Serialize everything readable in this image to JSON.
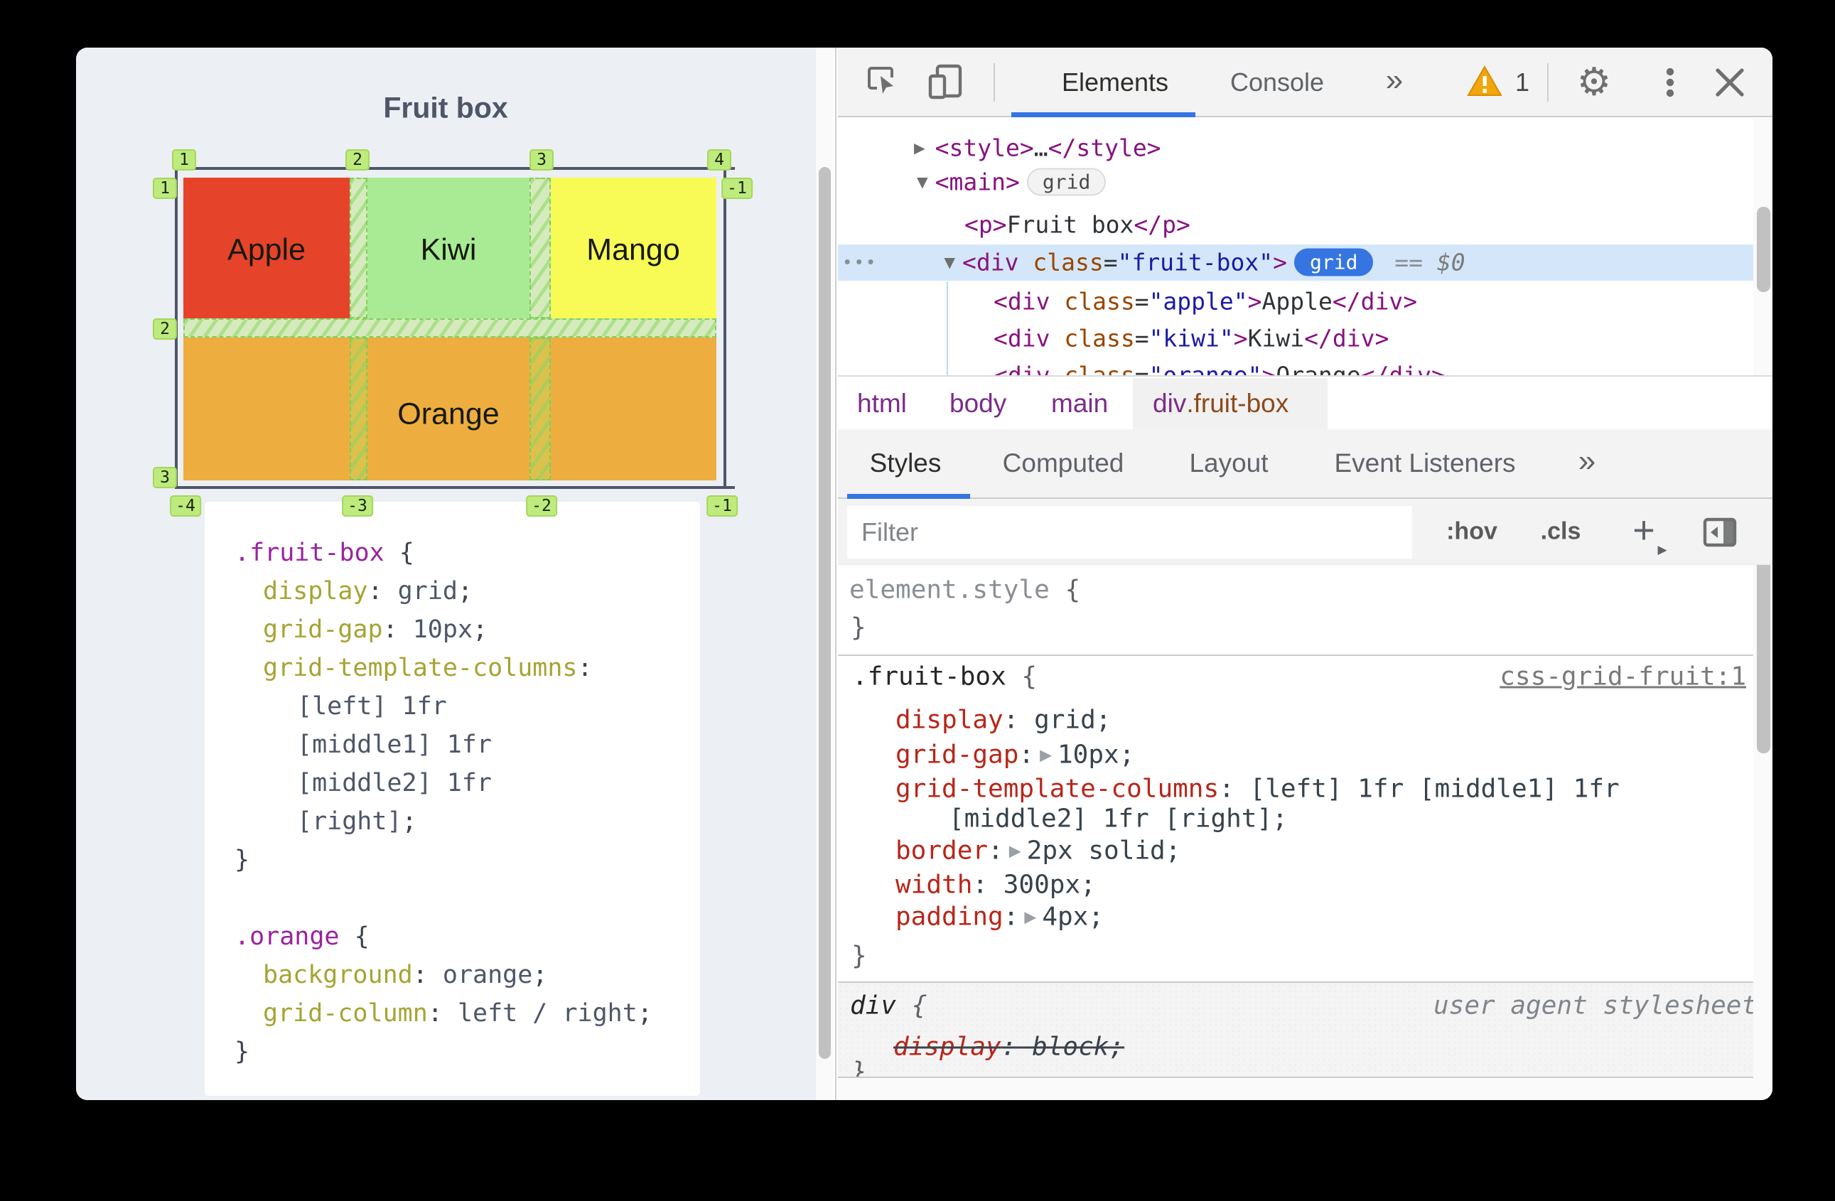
{
  "page": {
    "title": "Fruit box",
    "cells": {
      "apple": "Apple",
      "kiwi": "Kiwi",
      "mango": "Mango",
      "orange": "Orange"
    },
    "colors": {
      "apple": "#e6442a",
      "kiwi": "#a8eb94",
      "mango": "#f8fb56",
      "orange": "#edae3f",
      "overlay_line": "#4e5668",
      "badge_bg": "#beeb7d"
    },
    "overlay_badges": {
      "top": [
        "1",
        "2",
        "3",
        "4"
      ],
      "left": [
        "1",
        "2",
        "3"
      ],
      "right": [
        "-1"
      ],
      "bottom": [
        "-4",
        "-3",
        "-2",
        "-1"
      ]
    },
    "code": [
      {
        "parts": [
          {
            "t": ".fruit-box",
            "c": "psel"
          },
          {
            "t": " {",
            "c": "ppun"
          }
        ]
      },
      {
        "parts": [
          {
            "t": "display",
            "c": "pprop"
          },
          {
            "t": ": ",
            "c": "ppun"
          },
          {
            "t": "grid",
            "c": "pval"
          },
          {
            "t": ";",
            "c": "ppun"
          }
        ]
      },
      {
        "parts": [
          {
            "t": "grid-gap",
            "c": "pprop"
          },
          {
            "t": ": ",
            "c": "ppun"
          },
          {
            "t": "10px",
            "c": "pval"
          },
          {
            "t": ";",
            "c": "ppun"
          }
        ]
      },
      {
        "parts": [
          {
            "t": "grid-template-columns",
            "c": "pprop"
          },
          {
            "t": ":",
            "c": "ppun"
          }
        ]
      },
      {
        "parts": [
          {
            "t": "[left] 1fr",
            "c": "pval"
          }
        ]
      },
      {
        "parts": [
          {
            "t": "[middle1] 1fr",
            "c": "pval"
          }
        ]
      },
      {
        "parts": [
          {
            "t": "[middle2] 1fr",
            "c": "pval"
          }
        ]
      },
      {
        "parts": [
          {
            "t": "[right]",
            "c": "pval"
          },
          {
            "t": ";",
            "c": "ppun"
          }
        ]
      },
      {
        "parts": [
          {
            "t": "}",
            "c": "ppun"
          }
        ]
      },
      {
        "parts": []
      },
      {
        "parts": [
          {
            "t": ".orange",
            "c": "psel"
          },
          {
            "t": " {",
            "c": "ppun"
          }
        ]
      },
      {
        "parts": [
          {
            "t": "background",
            "c": "pprop"
          },
          {
            "t": ": ",
            "c": "ppun"
          },
          {
            "t": "orange",
            "c": "pval"
          },
          {
            "t": ";",
            "c": "ppun"
          }
        ]
      },
      {
        "parts": [
          {
            "t": "grid-column",
            "c": "pprop"
          },
          {
            "t": ": ",
            "c": "ppun"
          },
          {
            "t": "left / right",
            "c": "pval"
          },
          {
            "t": ";",
            "c": "ppun"
          }
        ]
      },
      {
        "parts": [
          {
            "t": "}",
            "c": "ppun"
          }
        ]
      }
    ]
  },
  "devtools": {
    "toolbar": {
      "tabs": [
        "Elements",
        "Console"
      ],
      "more": "»",
      "warning_count": "1"
    },
    "dom": {
      "rows": [
        {
          "a": [
            {
              "t": "<style>",
              "c": "tag"
            },
            {
              "t": "…",
              "c": "txt"
            },
            {
              "t": "</style>",
              "c": "tag"
            }
          ]
        },
        {
          "a": [
            {
              "t": "<main>",
              "c": "tag"
            }
          ],
          "pill": "grid"
        },
        {
          "a": [
            {
              "t": "<p>",
              "c": "tag"
            },
            {
              "t": "Fruit box",
              "c": "txt"
            },
            {
              "t": "</p>",
              "c": "tag"
            }
          ]
        },
        {
          "a": [
            {
              "t": "<div ",
              "c": "tag"
            },
            {
              "t": "class",
              "c": "attr"
            },
            {
              "t": "=",
              "c": "txt"
            },
            {
              "t": "\"fruit-box\"",
              "c": "str"
            },
            {
              "t": ">",
              "c": "tag"
            }
          ],
          "pill": "grid",
          "b": [
            {
              "t": " == ",
              "c": "gry"
            },
            {
              "t": "$0",
              "c": "dol"
            }
          ]
        },
        {
          "a": [
            {
              "t": "<div ",
              "c": "tag"
            },
            {
              "t": "class",
              "c": "attr"
            },
            {
              "t": "=",
              "c": "txt"
            },
            {
              "t": "\"apple\"",
              "c": "str"
            },
            {
              "t": ">",
              "c": "tag"
            },
            {
              "t": "Apple",
              "c": "txt"
            },
            {
              "t": "</div>",
              "c": "tag"
            }
          ]
        },
        {
          "a": [
            {
              "t": "<div ",
              "c": "tag"
            },
            {
              "t": "class",
              "c": "attr"
            },
            {
              "t": "=",
              "c": "txt"
            },
            {
              "t": "\"kiwi\"",
              "c": "str"
            },
            {
              "t": ">",
              "c": "tag"
            },
            {
              "t": "Kiwi",
              "c": "txt"
            },
            {
              "t": "</div>",
              "c": "tag"
            }
          ]
        },
        {
          "a": [
            {
              "t": "<div ",
              "c": "tag"
            },
            {
              "t": "class",
              "c": "attr"
            },
            {
              "t": "=",
              "c": "txt"
            },
            {
              "t": "\"orange\"",
              "c": "str"
            },
            {
              "t": ">",
              "c": "tag"
            },
            {
              "t": "Orange",
              "c": "txt"
            },
            {
              "t": "</div>",
              "c": "tag"
            }
          ]
        }
      ],
      "more_dots": "•••"
    },
    "breadcrumbs": {
      "items": [
        "html",
        "body",
        "main"
      ],
      "selected_tag": "div",
      "selected_class": ".fruit-box"
    },
    "sidebar_tabs": [
      "Styles",
      "Computed",
      "Layout",
      "Event Listeners"
    ],
    "sidebar_more": "»",
    "filter": {
      "placeholder": "Filter",
      "hov": ":hov",
      "cls": ".cls",
      "add": "+"
    },
    "styles": {
      "element_style": [
        {
          "t": "element.style ",
          "c": "gry"
        },
        {
          "t": "{",
          "c": "brace"
        }
      ],
      "element_style_close": [
        {
          "t": "}",
          "c": "brace"
        }
      ],
      "rule_selector": [
        {
          "t": ".fruit-box",
          "c": "sel"
        },
        {
          "t": " {",
          "c": "brace"
        }
      ],
      "rule_link": "css-grid-fruit:1",
      "props": {
        "display": [
          {
            "t": "display",
            "c": "prop"
          },
          {
            "t": ": ",
            "c": "val"
          },
          {
            "t": "grid;",
            "c": "val"
          }
        ],
        "grid_gap_name": [
          {
            "t": "grid-gap",
            "c": "prop"
          },
          {
            "t": ":",
            "c": "val"
          }
        ],
        "grid_gap_value": [
          {
            "t": "10px;",
            "c": "val"
          }
        ],
        "gtc_line1": [
          {
            "t": "grid-template-columns",
            "c": "prop"
          },
          {
            "t": ": ",
            "c": "val"
          },
          {
            "t": "[left] 1fr [middle1] 1fr",
            "c": "val"
          }
        ],
        "gtc_line2": [
          {
            "t": "[middle2] 1fr [right];",
            "c": "val"
          }
        ],
        "border_name": [
          {
            "t": "border",
            "c": "prop"
          },
          {
            "t": ":",
            "c": "val"
          }
        ],
        "border_value": [
          {
            "t": "2px solid;",
            "c": "val"
          }
        ],
        "width": [
          {
            "t": "width",
            "c": "prop"
          },
          {
            "t": ": ",
            "c": "val"
          },
          {
            "t": "300px;",
            "c": "val"
          }
        ],
        "padding_name": [
          {
            "t": "padding",
            "c": "prop"
          },
          {
            "t": ":",
            "c": "val"
          }
        ],
        "padding_value": [
          {
            "t": "4px;",
            "c": "val"
          }
        ],
        "close": [
          {
            "t": "}",
            "c": "brace"
          }
        ]
      },
      "ua_rule": {
        "selector": [
          {
            "t": "div ",
            "c": "sel"
          },
          {
            "t": "{",
            "c": "brace"
          }
        ],
        "origin": "user agent stylesheet",
        "strike_prop": [
          {
            "t": "display",
            "c": "prop"
          },
          {
            "t": ": ",
            "c": "val"
          },
          {
            "t": "block;",
            "c": "val"
          }
        ],
        "close": [
          {
            "t": "}",
            "c": "brace"
          }
        ]
      }
    }
  }
}
